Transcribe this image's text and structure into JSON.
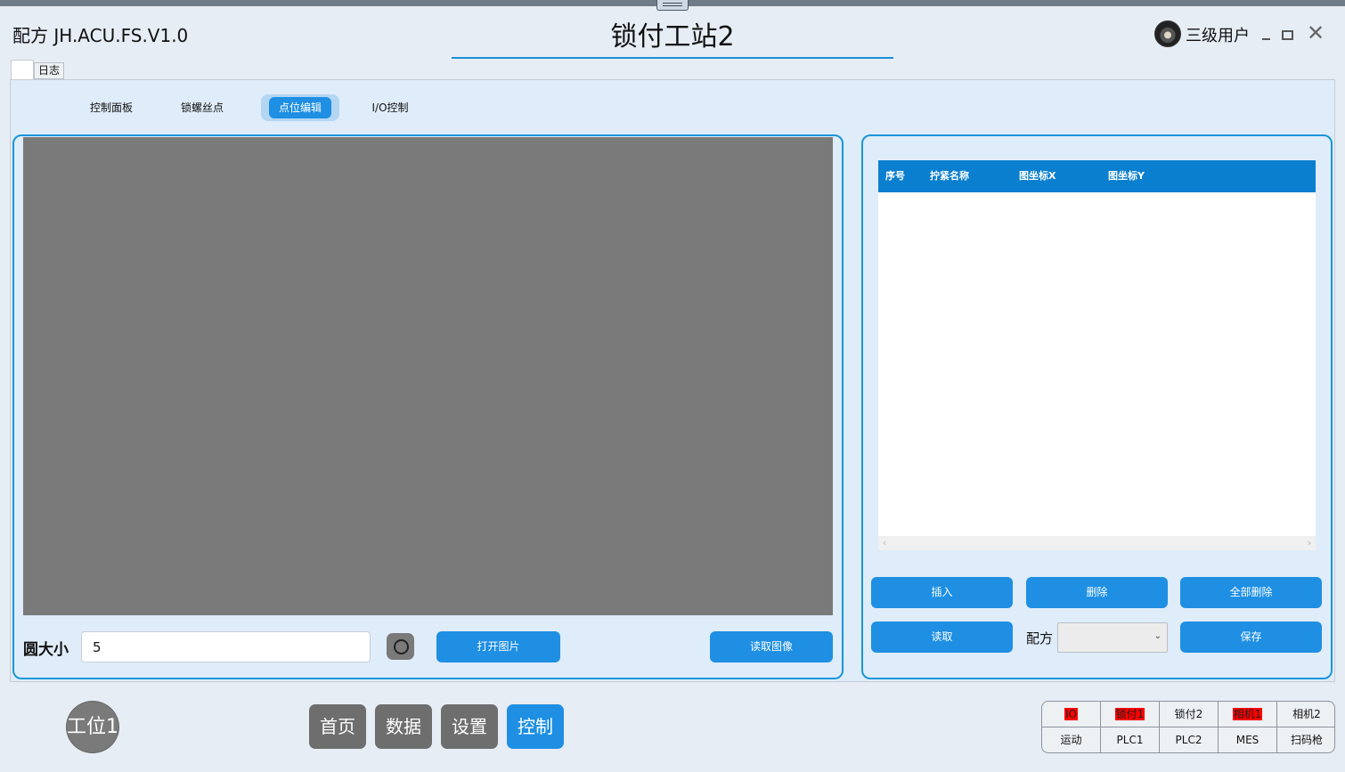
{
  "window": {
    "app_title": "配方 JH.ACU.FS.V1.0",
    "station_title": "锁付工站2",
    "user_label": "三级用户"
  },
  "outer_tabs": [
    {
      "label": ""
    },
    {
      "label": "日志"
    }
  ],
  "sub_tabs": [
    {
      "label": "控制面板",
      "active": false
    },
    {
      "label": "锁螺丝点",
      "active": false
    },
    {
      "label": "点位编辑",
      "active": true
    },
    {
      "label": "I/O控制",
      "active": false
    }
  ],
  "image_panel": {
    "circle_size_label": "圆大小",
    "circle_size_value": "5",
    "open_image_label": "打开图片",
    "read_image_label": "读取图像"
  },
  "point_table": {
    "columns": [
      "序号",
      "拧紧名称",
      "图坐标X",
      "图坐标Y"
    ],
    "rows": []
  },
  "actions": {
    "insert_label": "插入",
    "delete_label": "删除",
    "delete_all_label": "全部删除",
    "read_label": "读取",
    "recipe_label": "配方",
    "recipe_value": "",
    "save_label": "保存"
  },
  "footer": {
    "station_badge": "工位1",
    "nav": [
      {
        "label": "首页",
        "active": false
      },
      {
        "label": "数据",
        "active": false
      },
      {
        "label": "设置",
        "active": false
      },
      {
        "label": "控制",
        "active": true
      }
    ],
    "status": [
      {
        "label": "IO",
        "state": "error"
      },
      {
        "label": "锁付1",
        "state": "error"
      },
      {
        "label": "锁付2",
        "state": "ok"
      },
      {
        "label": "相机1",
        "state": "error"
      },
      {
        "label": "相机2",
        "state": "ok"
      },
      {
        "label": "运动",
        "state": "ok"
      },
      {
        "label": "PLC1",
        "state": "ok"
      },
      {
        "label": "PLC2",
        "state": "ok"
      },
      {
        "label": "MES",
        "state": "ok"
      },
      {
        "label": "扫码枪",
        "state": "ok"
      }
    ]
  },
  "colors": {
    "accent": "#1e8fe3",
    "header_blue": "#0b7fcf",
    "error_red": "#ff0000",
    "nav_gray": "#6e6e6e"
  }
}
